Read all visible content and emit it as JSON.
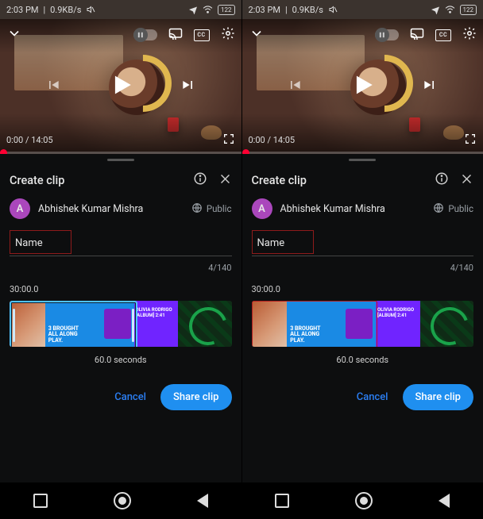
{
  "status": {
    "time": "2:03 PM",
    "net": "0.9KB/s",
    "battery": "122"
  },
  "player": {
    "current": "0:00",
    "sep": " / ",
    "total": "14:05"
  },
  "sheet": {
    "title": "Create clip",
    "user": {
      "initial": "A",
      "name": "Abhishek Kumar Mishra"
    },
    "visibility": "Public",
    "name_label": "Name",
    "char_count": "4/140",
    "timestamp": "30:00.0",
    "duration": "60.0 seconds",
    "seg_text": "3 BROUGHT\nALL ALONG\nPLAY.",
    "purple_text": "OLIVIA RODRIGO\n[ALBUM] 2:41",
    "cancel": "Cancel",
    "share": "Share clip"
  },
  "cc_label": "CC"
}
